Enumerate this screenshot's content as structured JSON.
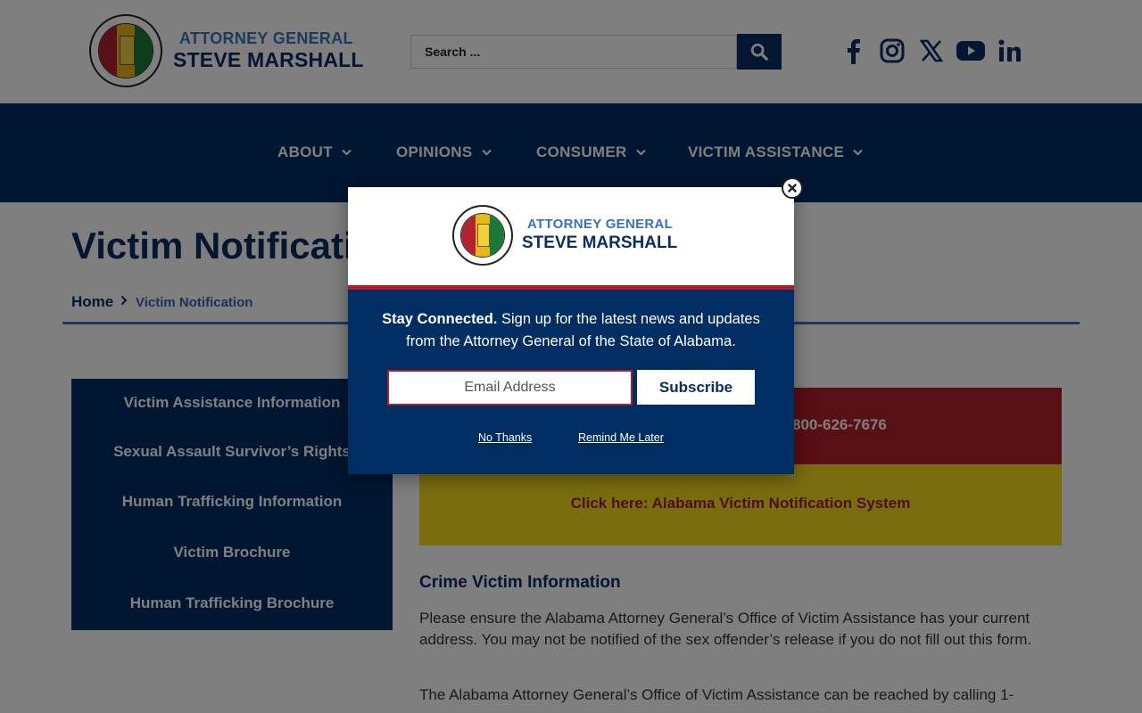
{
  "header": {
    "brand_line1": "ATTORNEY GENERAL",
    "brand_line2": "STEVE MARSHALL",
    "search_placeholder": "Search ...",
    "social": [
      "facebook-icon",
      "instagram-icon",
      "x-icon",
      "youtube-icon",
      "linkedin-icon"
    ]
  },
  "nav": {
    "items": [
      {
        "label": "ABOUT"
      },
      {
        "label": "OPINIONS"
      },
      {
        "label": "CONSUMER"
      },
      {
        "label": "VICTIM ASSISTANCE"
      }
    ]
  },
  "page": {
    "title": "Victim Notification",
    "breadcrumb_home": "Home",
    "breadcrumb_current": "Victim Notification"
  },
  "sidebar": {
    "items": [
      {
        "label": "Victim Assistance Information"
      },
      {
        "label": "Sexual Assault Survivor’s Rights"
      },
      {
        "label": "Human Trafficking Information"
      },
      {
        "label": "Victim Brochure"
      },
      {
        "label": "Human Trafficking Brochure"
      }
    ]
  },
  "content": {
    "phone_text": "800-626-7676",
    "notification_link": "Click here: Alabama Victim Notification System",
    "section_heading": "Crime Victim Information",
    "paragraph1": "Please ensure the Alabama Attorney General’s Office of Victim Assistance has your current address. You may not be notified of the sex offender’s release if you do not fill out this form.",
    "paragraph2": "The Alabama Attorney General’s Office of Victim Assistance can be reached by calling 1-"
  },
  "modal": {
    "brand_line1": "ATTORNEY GENERAL",
    "brand_line2": "STEVE MARSHALL",
    "headline_bold": "Stay Connected.",
    "headline_rest": " Sign up for the latest news and updates from the Attorney General of the State of Alabama.",
    "email_placeholder": "Email Address",
    "subscribe_label": "Subscribe",
    "no_thanks": "No Thanks",
    "remind_later": "Remind Me Later"
  },
  "colors": {
    "navy": "#002d62",
    "brand_blue": "#3a72b8",
    "red": "#b01e2d",
    "yellow": "#f2db1e"
  }
}
